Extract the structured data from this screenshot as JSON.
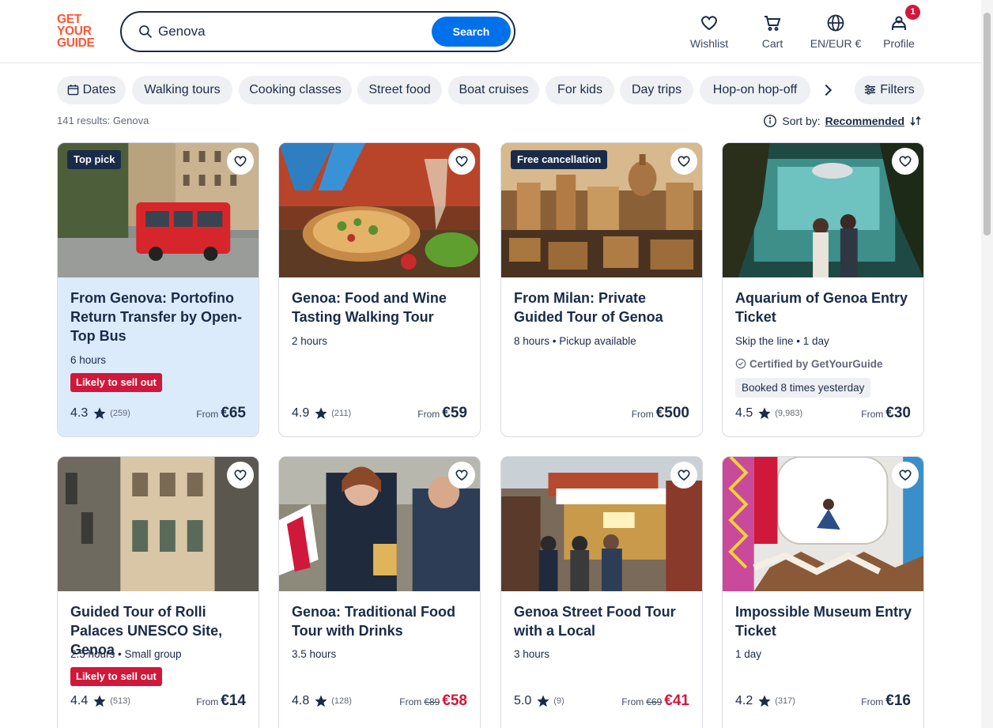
{
  "header": {
    "logo_lines": [
      "GET",
      "YOUR",
      "GUIDE"
    ],
    "search_value": "Genova",
    "search_button": "Search",
    "nav": [
      {
        "label": "Wishlist",
        "icon": "heart-icon"
      },
      {
        "label": "Cart",
        "icon": "cart-icon"
      },
      {
        "label": "EN/EUR €",
        "icon": "globe-icon"
      },
      {
        "label": "Profile",
        "icon": "profile-icon",
        "badge": "1"
      }
    ]
  },
  "filters": {
    "chips": [
      "Dates",
      "Walking tours",
      "Cooking classes",
      "Street food",
      "Boat cruises",
      "For kids",
      "Day trips",
      "Hop-on hop-off"
    ],
    "filters_label": "Filters"
  },
  "results": {
    "count_text": "141 results: Genova",
    "sort_label": "Sort by:",
    "sort_value": "Recommended"
  },
  "cards": [
    {
      "tag": "Top pick",
      "title": "From Genova: Portofino Return Transfer by Open-Top Bus",
      "meta": "6 hours",
      "badge": "Likely to sell out",
      "rating": "4.3",
      "reviews": "(259)",
      "from": "From",
      "price": "€65"
    },
    {
      "tag": "",
      "title": "Genoa: Food and Wine Tasting Walking Tour",
      "meta": "2 hours",
      "rating": "4.9",
      "reviews": "(211)",
      "from": "From",
      "price": "€59"
    },
    {
      "tag": "Free cancellation",
      "title": "From Milan: Private Guided Tour of Genoa",
      "meta": "8 hours • Pickup available",
      "from": "From",
      "price": "€500"
    },
    {
      "tag": "",
      "title": "Aquarium of Genoa Entry Ticket",
      "meta": "Skip the line • 1 day",
      "certified": "Certified by GetYourGuide",
      "booked": "Booked 8 times yesterday",
      "rating": "4.5",
      "reviews": "(9,983)",
      "from": "From",
      "price": "€30"
    },
    {
      "tag": "",
      "title": "Guided Tour of Rolli Palaces UNESCO Site, Genoa",
      "meta": "2.5 hours • Small group",
      "badge": "Likely to sell out",
      "rating": "4.4",
      "reviews": "(513)",
      "from": "From",
      "price": "€14"
    },
    {
      "tag": "",
      "title": "Genoa: Traditional Food Tour with Drinks",
      "meta": "3.5 hours",
      "rating": "4.8",
      "reviews": "(128)",
      "from": "From",
      "old_price": "€89",
      "price": "€58"
    },
    {
      "tag": "",
      "title": "Genoa Street Food Tour with a Local",
      "meta": "3 hours",
      "rating": "5.0",
      "reviews": "(9)",
      "from": "From",
      "old_price": "€69",
      "price": "€41"
    },
    {
      "tag": "",
      "title": "Impossible Museum Entry Ticket",
      "meta": "1 day",
      "rating": "4.2",
      "reviews": "(317)",
      "from": "From",
      "price": "€16"
    }
  ],
  "colors": {
    "brand": "#ff5533",
    "primary": "#0071eb",
    "ink": "#1a2b49",
    "sale": "#d0183b",
    "highlight": "#dcebfc"
  }
}
